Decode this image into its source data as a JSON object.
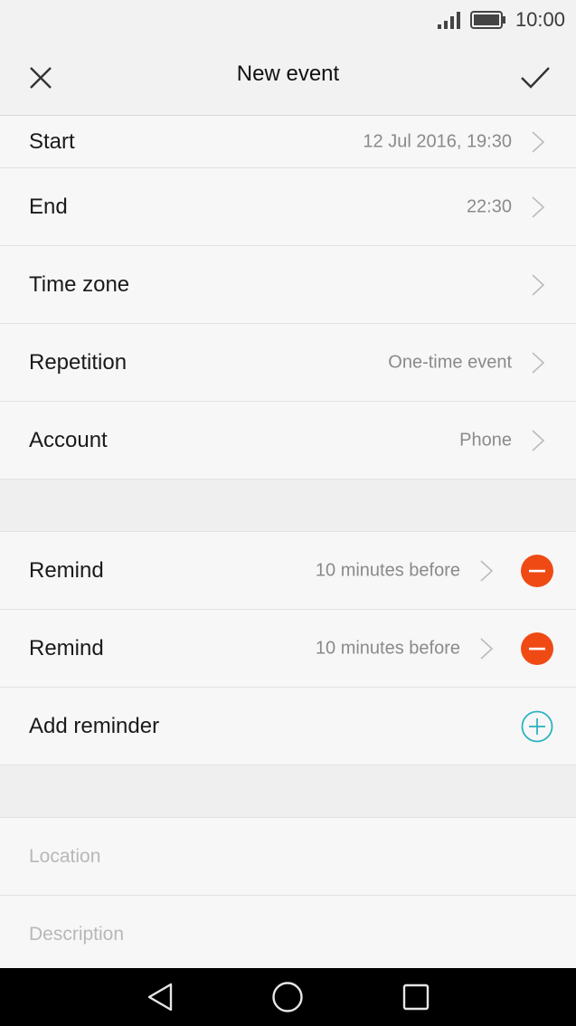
{
  "status_bar": {
    "time": "10:00",
    "icons": [
      "signal-icon",
      "battery-icon"
    ]
  },
  "app_bar": {
    "title": "New event",
    "close_icon": "close-icon",
    "confirm_icon": "check-icon"
  },
  "rows": {
    "start": {
      "label": "Start",
      "value": "12 Jul 2016, 19:30"
    },
    "end": {
      "label": "End",
      "value": "22:30"
    },
    "time_zone": {
      "label": "Time zone",
      "value": ""
    },
    "repetition": {
      "label": "Repetition",
      "value": "One-time event"
    },
    "account": {
      "label": "Account",
      "value": "Phone"
    }
  },
  "reminders": [
    {
      "label": "Remind",
      "value": "10 minutes before"
    },
    {
      "label": "Remind",
      "value": "10 minutes before"
    }
  ],
  "add_reminder": {
    "label": "Add reminder"
  },
  "location": {
    "placeholder": "Location"
  },
  "description": {
    "placeholder": "Description"
  },
  "colors": {
    "remove": "#f04a14",
    "add": "#2bb3c0",
    "nav_bg": "#000000"
  }
}
